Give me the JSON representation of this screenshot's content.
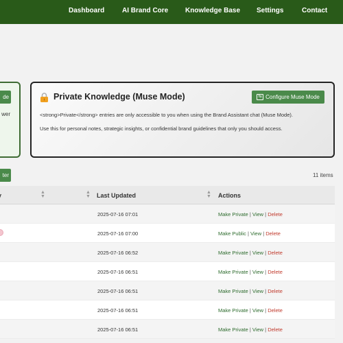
{
  "nav": {
    "items": [
      "Dashboard",
      "AI Brand Core",
      "Knowledge Base",
      "Settings",
      "Contact"
    ]
  },
  "left_card": {
    "button_label": "de",
    "text": "wer"
  },
  "muse_card": {
    "title": "Private Knowledge (Muse Mode)",
    "button_label": "Configure Muse Mode",
    "line1": "<strong>Private</strong> entries are only accessible to you when using the Brand Assistant chat (Muse Mode).",
    "line2": "Use this for personal notes, strategic insights, or confidential brand guidelines that only you should access."
  },
  "toolbar": {
    "filter_label": "ter",
    "item_count": "11 items"
  },
  "table": {
    "headers": {
      "col1": "y",
      "last_updated": "Last Updated",
      "actions": "Actions"
    },
    "rows": [
      {
        "date": "2025-07-16 07:01",
        "toggle": "Make Private",
        "view": "View",
        "delete": "Delete"
      },
      {
        "date": "2025-07-16 07:00",
        "toggle": "Make Public",
        "view": "View",
        "delete": "Delete"
      },
      {
        "date": "2025-07-16 06:52",
        "toggle": "Make Private",
        "view": "View",
        "delete": "Delete"
      },
      {
        "date": "2025-07-16 06:51",
        "toggle": "Make Private",
        "view": "View",
        "delete": "Delete"
      },
      {
        "date": "2025-07-16 06:51",
        "toggle": "Make Private",
        "view": "View",
        "delete": "Delete"
      },
      {
        "date": "2025-07-16 06:51",
        "toggle": "Make Private",
        "view": "View",
        "delete": "Delete"
      },
      {
        "date": "2025-07-16 06:51",
        "toggle": "Make Private",
        "view": "View",
        "delete": "Delete"
      }
    ],
    "separator": "|"
  },
  "colors": {
    "nav_bg": "#295a19",
    "button_green": "#4a8a4a",
    "link_green": "#2d6b2d",
    "delete_red": "#c0392b",
    "lock_orange": "#f0a020"
  },
  "icons": {
    "lock": "lock-icon",
    "muse": "muse-mode-icon",
    "sort": "sort-arrows-icon",
    "row_marker": "private-dot-icon"
  }
}
